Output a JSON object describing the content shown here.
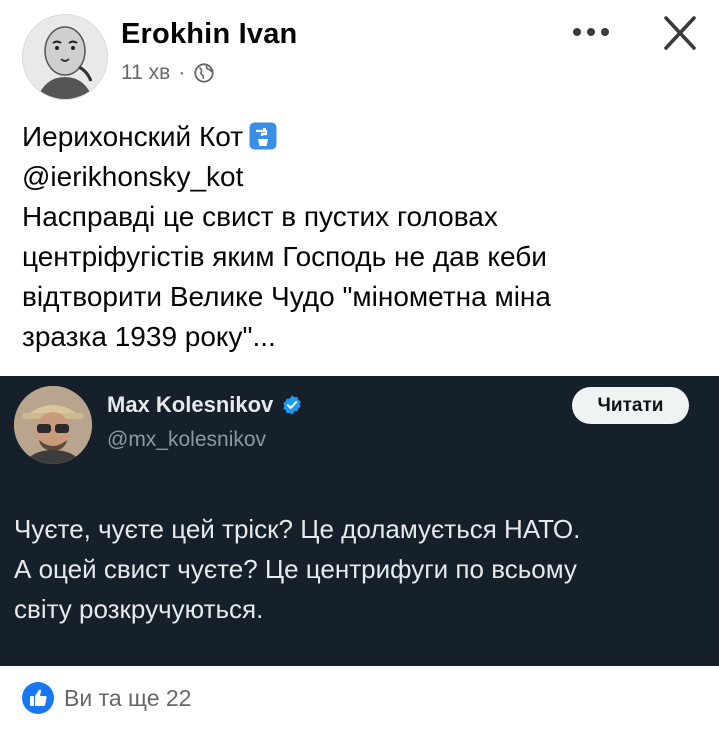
{
  "post": {
    "author": "Erokhin Ivan",
    "time": "11 хв",
    "separator": "·",
    "privacy_icon": "globe-icon",
    "text_lines": [
      "Иерихонский Кот",
      "@ierikhonsky_kot",
      "Насправді це свист в пустих головах",
      "центріфугістів яким Господь не дав кеби",
      "відтворити Велике Чудо \"мінометна міна",
      "зразка 1939 року\"..."
    ]
  },
  "tweet": {
    "name": "Max Kolesnikov",
    "handle": "@mx_kolesnikov",
    "follow_label": "Читати",
    "text_lines": [
      "Чуєте, чуєте цей тріск? Це доламується НАТО.",
      "А оцей свист чуєте? Це центрифуги по всьому",
      "світу розкручуються."
    ]
  },
  "reactions": {
    "summary": "Ви та ще 22",
    "icon": "like-icon"
  },
  "colors": {
    "tweet_bg": "#15202b",
    "tweet_text": "#e7e9ea",
    "tweet_muted": "#8b98a5",
    "verified": "#1d9bf0",
    "fb_blue": "#1877f2",
    "muted": "#65676b"
  }
}
